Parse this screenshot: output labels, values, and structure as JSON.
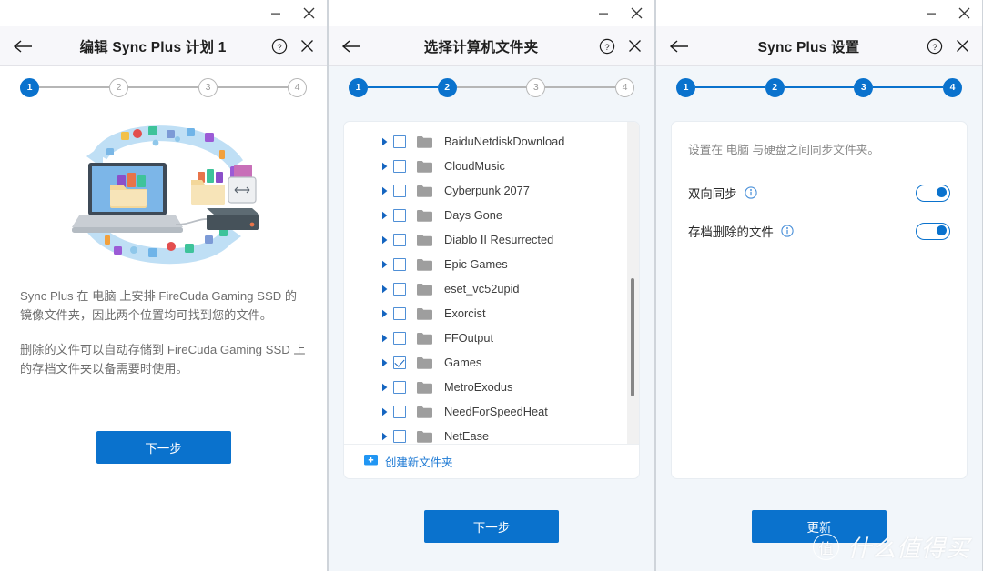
{
  "window_controls": {
    "minimize": "minimize-icon",
    "close": "close-icon"
  },
  "panels": [
    {
      "id": "panel-edit-plan",
      "header": {
        "back": "back-arrow-icon",
        "title": "编辑 Sync Plus 计划 1",
        "help": "help-icon",
        "close": "close-icon"
      },
      "stepper": {
        "steps": [
          "1",
          "2",
          "3",
          "4"
        ],
        "active": 1
      },
      "illustration": "sync-laptop-drive-illustration",
      "paragraphs": [
        "Sync Plus 在 电脑 上安排 FireCuda Gaming SSD 的镜像文件夹，因此两个位置均可找到您的文件。",
        "删除的文件可以自动存储到 FireCuda Gaming SSD 上的存档文件夹以备需要时使用。"
      ],
      "primary_button": "下一步"
    },
    {
      "id": "panel-select-folder",
      "header": {
        "back": "back-arrow-icon",
        "title": "选择计算机文件夹",
        "help": "help-icon",
        "close": "close-icon"
      },
      "stepper": {
        "steps": [
          "1",
          "2",
          "3",
          "4"
        ],
        "active": 2
      },
      "folders": [
        {
          "name": "BaiduNetdiskDownload",
          "checked": false
        },
        {
          "name": "CloudMusic",
          "checked": false
        },
        {
          "name": "Cyberpunk 2077",
          "checked": false
        },
        {
          "name": "Days Gone",
          "checked": false
        },
        {
          "name": "Diablo II Resurrected",
          "checked": false
        },
        {
          "name": "Epic Games",
          "checked": false
        },
        {
          "name": "eset_vc52upid",
          "checked": false
        },
        {
          "name": "Exorcist",
          "checked": false
        },
        {
          "name": "FFOutput",
          "checked": false
        },
        {
          "name": "Games",
          "checked": true
        },
        {
          "name": "MetroExodus",
          "checked": false
        },
        {
          "name": "NeedForSpeedHeat",
          "checked": false
        },
        {
          "name": "NetEase",
          "checked": false
        }
      ],
      "new_folder_label": "创建新文件夹",
      "new_folder_icon": "new-folder-icon",
      "primary_button": "下一步"
    },
    {
      "id": "panel-sync-settings",
      "header": {
        "back": "back-arrow-icon",
        "title": "Sync Plus 设置",
        "help": "help-icon",
        "close": "close-icon"
      },
      "stepper": {
        "steps": [
          "1",
          "2",
          "3",
          "4"
        ],
        "active": 4
      },
      "description": "设置在 电脑 与硬盘之间同步文件夹。",
      "settings": [
        {
          "label": "双向同步",
          "info": "info-icon",
          "on": true
        },
        {
          "label": "存档删除的文件",
          "info": "info-icon",
          "on": true
        }
      ],
      "primary_button": "更新"
    }
  ],
  "watermark": {
    "mark": "值",
    "text": "什么值得买"
  },
  "colors": {
    "accent": "#0a72cd",
    "panel_tint": "#f2f6fa",
    "header_bg": "#f7f7fa",
    "step_inactive": "#b6b6b6",
    "link": "#1e7ad4"
  }
}
